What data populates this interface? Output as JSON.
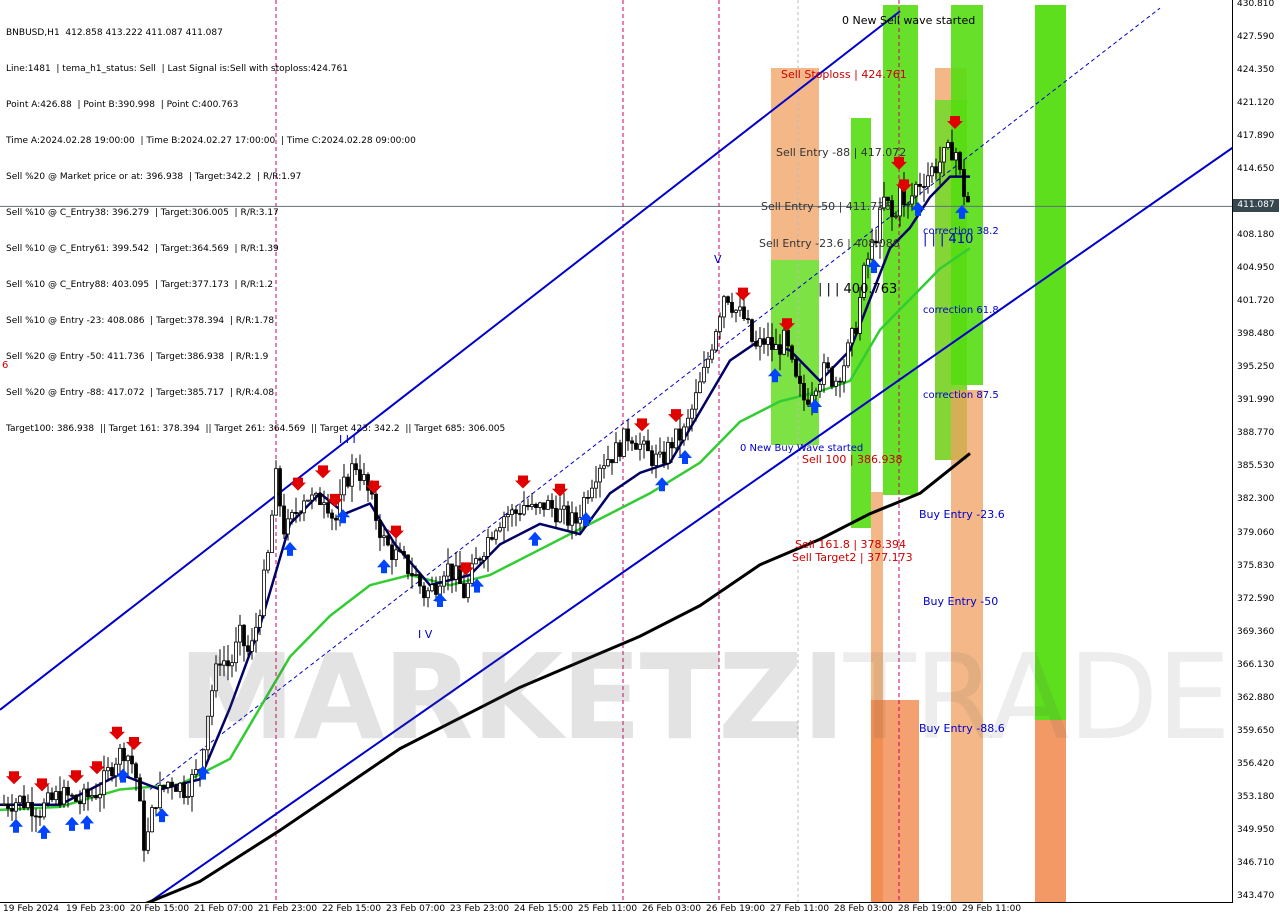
{
  "info": {
    "lines": [
      "BNBUSD,H1  412.858 413.222 411.087 411.087",
      "Line:1481  | tema_h1_status: Sell  | Last Signal is:Sell with stoploss:424.761",
      "Point A:426.88  | Point B:390.998  | Point C:400.763",
      "Time A:2024.02.28 19:00:00  | Time B:2024.02.27 17:00:00  | Time C:2024.02.28 09:00:00",
      "Sell %20 @ Market price or at: 396.938  | Target:342.2  | R/R:1.97",
      "Sell %10 @ C_Entry38: 396.279  | Target:306.005  | R/R:3.17",
      "Sell %10 @ C_Entry61: 399.542  | Target:364.569  | R/R:1.39",
      "Sell %10 @ C_Entry88: 403.095  | Target:377.173  | R/R:1.2",
      "Sell %10 @ Entry -23: 408.086  | Target:378.394  | R/R:1.78",
      "Sell %20 @ Entry -50: 411.736  | Target:386.938  | R/R:1.9",
      "Sell %20 @ Entry -88: 417.072  | Target:385.717  | R/R:4.08",
      "Target100: 386.938  || Target 161: 378.394  || Target 261: 364.569  || Target 423: 342.2  || Target 685: 306.005"
    ]
  },
  "left_marker": "6",
  "current_price": "411.087",
  "watermark": {
    "bold": "MARKETZI",
    "light": "TRADE"
  },
  "price_axis": {
    "ticks": [
      "430.810",
      "427.590",
      "424.350",
      "421.120",
      "417.890",
      "414.650",
      "411.087",
      "408.180",
      "404.950",
      "401.720",
      "398.480",
      "395.250",
      "391.990",
      "388.770",
      "385.530",
      "382.300",
      "379.060",
      "375.830",
      "372.590",
      "369.360",
      "366.130",
      "362.880",
      "359.650",
      "356.420",
      "353.180",
      "349.950",
      "346.710",
      "343.470"
    ],
    "min": 343.47,
    "max": 430.81
  },
  "time_axis": {
    "ticks": [
      "19 Feb 2024",
      "19 Feb 23:00",
      "20 Feb 15:00",
      "21 Feb 07:00",
      "21 Feb 23:00",
      "22 Feb 15:00",
      "23 Feb 07:00",
      "23 Feb 23:00",
      "24 Feb 15:00",
      "25 Feb 11:00",
      "26 Feb 03:00",
      "26 Feb 19:00",
      "27 Feb 11:00",
      "28 Feb 03:00",
      "28 Feb 19:00",
      "29 Feb 11:00"
    ]
  },
  "labels": {
    "new_sell_wave": "0 New Sell wave started",
    "sell_stoploss": "Sell Stoploss | 424.761",
    "sell_entry_88": "Sell Entry -88 | 417.072",
    "sell_entry_50": "Sell Entry -50 | 411.736",
    "sell_entry_23": "Sell Entry -23.6 | 408.086",
    "level_400": "| | | 400.763",
    "correction_38": "correction 38.2",
    "level_410": "| | | 410",
    "correction_61": "correction 61.8",
    "correction_87": "correction 87.5",
    "new_buy_wave": "0 New Buy Wave started",
    "sell_100": "Sell 100 | 386.938",
    "buy_entry_23": "Buy Entry -23.6",
    "sell_161": "Sell 161.8 | 378.394",
    "sell_target2": "Sell Target2 | 377.173",
    "buy_entry_50": "Buy Entry -50",
    "buy_entry_88": "Buy Entry -88.6",
    "wave_v": "V",
    "wave_iii": "I I I",
    "wave_iv": "I V"
  },
  "chart_data": {
    "type": "candlestick",
    "symbol": "BNBUSD",
    "timeframe": "H1",
    "ylim": [
      343.47,
      430.81
    ],
    "colors": {
      "up_candle": "#000000",
      "down_candle": "#000000",
      "channel": "#0000cc",
      "fast_ma": "#000066",
      "slow_ma": "#33cc33",
      "long_ma": "#000000",
      "sell_arrow": "#e00000",
      "buy_arrow": "#0044ff"
    },
    "close_path": [
      [
        0,
        352.5
      ],
      [
        20,
        353
      ],
      [
        40,
        352
      ],
      [
        60,
        353.5
      ],
      [
        80,
        352.8
      ],
      [
        100,
        354
      ],
      [
        115,
        357
      ],
      [
        125,
        358
      ],
      [
        135,
        356
      ],
      [
        145,
        348
      ],
      [
        155,
        353
      ],
      [
        170,
        355
      ],
      [
        185,
        354
      ],
      [
        200,
        356
      ],
      [
        210,
        363
      ],
      [
        220,
        367
      ],
      [
        230,
        366
      ],
      [
        240,
        369
      ],
      [
        250,
        367
      ],
      [
        260,
        372
      ],
      [
        270,
        378
      ],
      [
        275,
        385
      ],
      [
        285,
        379
      ],
      [
        295,
        381
      ],
      [
        305,
        383
      ],
      [
        315,
        382
      ],
      [
        325,
        383
      ],
      [
        335,
        380
      ],
      [
        345,
        384
      ],
      [
        355,
        386
      ],
      [
        365,
        384
      ],
      [
        375,
        381
      ],
      [
        385,
        378
      ],
      [
        395,
        377
      ],
      [
        405,
        376
      ],
      [
        415,
        375
      ],
      [
        425,
        373
      ],
      [
        435,
        374
      ],
      [
        445,
        376
      ],
      [
        455,
        375
      ],
      [
        465,
        373
      ],
      [
        475,
        376
      ],
      [
        485,
        378
      ],
      [
        495,
        380
      ],
      [
        505,
        381
      ],
      [
        515,
        381
      ],
      [
        525,
        382
      ],
      [
        535,
        381
      ],
      [
        545,
        382
      ],
      [
        560,
        381
      ],
      [
        575,
        380
      ],
      [
        590,
        384
      ],
      [
        600,
        386
      ],
      [
        615,
        387
      ],
      [
        630,
        389
      ],
      [
        645,
        387
      ],
      [
        660,
        386
      ],
      [
        672,
        388
      ],
      [
        685,
        389
      ],
      [
        695,
        392
      ],
      [
        705,
        395
      ],
      [
        715,
        399
      ],
      [
        725,
        403
      ],
      [
        735,
        401
      ],
      [
        745,
        400
      ],
      [
        755,
        397
      ],
      [
        765,
        398
      ],
      [
        775,
        397
      ],
      [
        785,
        398
      ],
      [
        795,
        394
      ],
      [
        805,
        392
      ],
      [
        815,
        394
      ],
      [
        825,
        395
      ],
      [
        835,
        394
      ],
      [
        845,
        396
      ],
      [
        855,
        399
      ],
      [
        865,
        405
      ],
      [
        875,
        408
      ],
      [
        885,
        412
      ],
      [
        895,
        409
      ],
      [
        900,
        414
      ],
      [
        905,
        410
      ],
      [
        915,
        413
      ],
      [
        925,
        414
      ],
      [
        935,
        415
      ],
      [
        945,
        416
      ],
      [
        955,
        417
      ],
      [
        962,
        413
      ],
      [
        970,
        411.087
      ]
    ],
    "ma_fast": [
      [
        0,
        352.5
      ],
      [
        60,
        352.5
      ],
      [
        120,
        355.5
      ],
      [
        160,
        354
      ],
      [
        200,
        355
      ],
      [
        230,
        362
      ],
      [
        260,
        370
      ],
      [
        290,
        380
      ],
      [
        320,
        383
      ],
      [
        345,
        381
      ],
      [
        370,
        382
      ],
      [
        395,
        378
      ],
      [
        430,
        374
      ],
      [
        470,
        375
      ],
      [
        500,
        378
      ],
      [
        540,
        380
      ],
      [
        580,
        379
      ],
      [
        610,
        383
      ],
      [
        640,
        385
      ],
      [
        670,
        386
      ],
      [
        700,
        391
      ],
      [
        730,
        396
      ],
      [
        760,
        398
      ],
      [
        790,
        397
      ],
      [
        820,
        394
      ],
      [
        850,
        397
      ],
      [
        870,
        402
      ],
      [
        890,
        407
      ],
      [
        910,
        409
      ],
      [
        930,
        412
      ],
      [
        950,
        414
      ],
      [
        970,
        414
      ]
    ],
    "ma_slow": [
      [
        0,
        352
      ],
      [
        60,
        352.3
      ],
      [
        120,
        354
      ],
      [
        180,
        354.5
      ],
      [
        230,
        357
      ],
      [
        260,
        362
      ],
      [
        290,
        367
      ],
      [
        330,
        371
      ],
      [
        370,
        374
      ],
      [
        410,
        375
      ],
      [
        450,
        374
      ],
      [
        490,
        375
      ],
      [
        530,
        377
      ],
      [
        570,
        379
      ],
      [
        610,
        381
      ],
      [
        650,
        383
      ],
      [
        700,
        386
      ],
      [
        740,
        390
      ],
      [
        780,
        392
      ],
      [
        820,
        393
      ],
      [
        850,
        394
      ],
      [
        880,
        399
      ],
      [
        910,
        402
      ],
      [
        940,
        405
      ],
      [
        970,
        407
      ]
    ],
    "ma_long": [
      [
        0,
        338
      ],
      [
        100,
        341
      ],
      [
        200,
        345
      ],
      [
        280,
        350
      ],
      [
        340,
        354
      ],
      [
        400,
        358
      ],
      [
        460,
        361
      ],
      [
        520,
        364
      ],
      [
        580,
        366.5
      ],
      [
        640,
        369
      ],
      [
        700,
        372
      ],
      [
        760,
        376
      ],
      [
        820,
        378.5
      ],
      [
        870,
        381
      ],
      [
        920,
        383
      ],
      [
        970,
        386.9
      ]
    ],
    "channel_upper": [
      [
        0,
        361.8
      ],
      [
        900,
        430.2
      ]
    ],
    "channel_mid": [
      [
        150,
        354
      ],
      [
        1160,
        430.5
      ]
    ],
    "channel_lower": [
      [
        150,
        343
      ],
      [
        1235,
        417
      ]
    ]
  }
}
